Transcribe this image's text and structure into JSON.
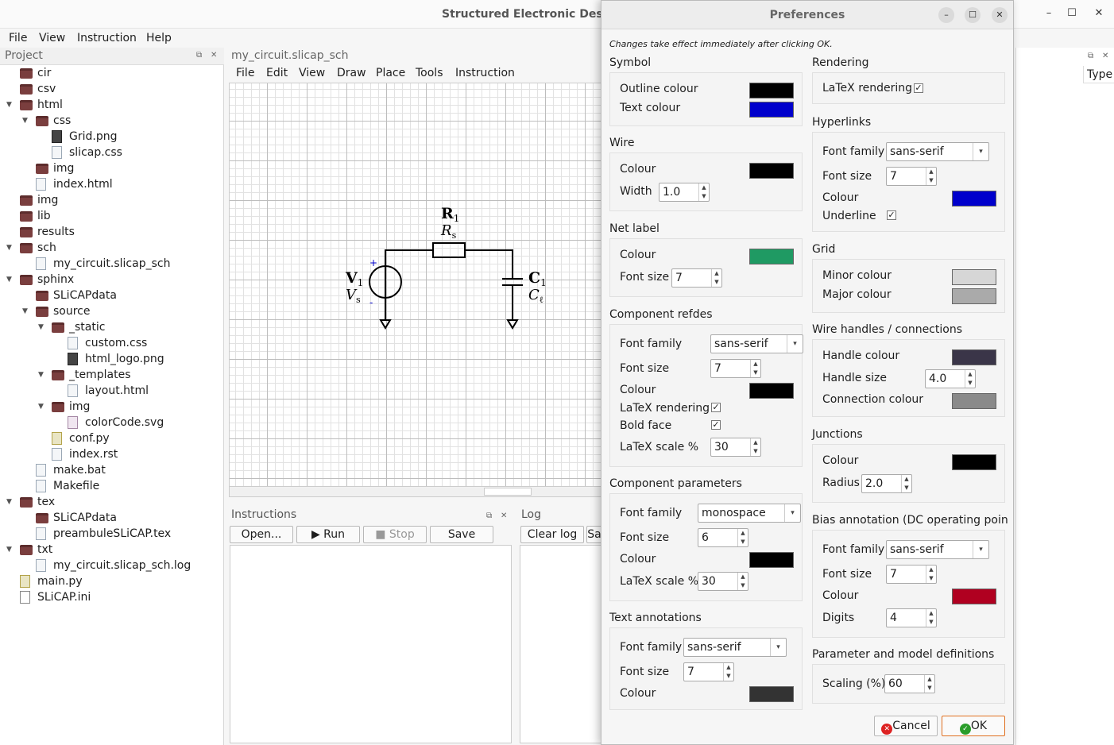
{
  "window": {
    "title": "Structured Electronic Design"
  },
  "menubar": [
    "File",
    "View",
    "Instruction",
    "Help"
  ],
  "project": {
    "title": "Project",
    "tree": [
      {
        "d": 0,
        "t": "folder",
        "n": "cir"
      },
      {
        "d": 0,
        "t": "folder",
        "n": "csv"
      },
      {
        "d": 0,
        "t": "folder",
        "n": "html",
        "open": true
      },
      {
        "d": 1,
        "t": "folder",
        "n": "css",
        "open": true
      },
      {
        "d": 2,
        "t": "img",
        "n": "Grid.png"
      },
      {
        "d": 2,
        "t": "file",
        "n": "slicap.css"
      },
      {
        "d": 1,
        "t": "folder",
        "n": "img"
      },
      {
        "d": 1,
        "t": "file",
        "n": "index.html"
      },
      {
        "d": 0,
        "t": "folder",
        "n": "img"
      },
      {
        "d": 0,
        "t": "folder",
        "n": "lib"
      },
      {
        "d": 0,
        "t": "folder",
        "n": "results"
      },
      {
        "d": 0,
        "t": "folder",
        "n": "sch",
        "open": true
      },
      {
        "d": 1,
        "t": "file",
        "n": "my_circuit.slicap_sch"
      },
      {
        "d": 0,
        "t": "folder",
        "n": "sphinx",
        "open": true
      },
      {
        "d": 1,
        "t": "folder",
        "n": "SLiCAPdata"
      },
      {
        "d": 1,
        "t": "folder",
        "n": "source",
        "open": true
      },
      {
        "d": 2,
        "t": "folder",
        "n": "_static",
        "open": true
      },
      {
        "d": 3,
        "t": "file",
        "n": "custom.css"
      },
      {
        "d": 3,
        "t": "img",
        "n": "html_logo.png"
      },
      {
        "d": 2,
        "t": "folder",
        "n": "_templates",
        "open": true
      },
      {
        "d": 3,
        "t": "file",
        "n": "layout.html"
      },
      {
        "d": 2,
        "t": "folder",
        "n": "img",
        "open": true
      },
      {
        "d": 3,
        "t": "svg",
        "n": "colorCode.svg"
      },
      {
        "d": 2,
        "t": "py",
        "n": "conf.py"
      },
      {
        "d": 2,
        "t": "file",
        "n": "index.rst"
      },
      {
        "d": 1,
        "t": "file",
        "n": "make.bat"
      },
      {
        "d": 1,
        "t": "file",
        "n": "Makefile"
      },
      {
        "d": 0,
        "t": "folder",
        "n": "tex",
        "open": true
      },
      {
        "d": 1,
        "t": "folder",
        "n": "SLiCAPdata"
      },
      {
        "d": 1,
        "t": "file",
        "n": "preambuleSLiCAP.tex"
      },
      {
        "d": 0,
        "t": "folder",
        "n": "txt",
        "open": true
      },
      {
        "d": 1,
        "t": "file",
        "n": "my_circuit.slicap_sch.log"
      },
      {
        "d": 0,
        "t": "py",
        "n": "main.py"
      },
      {
        "d": 0,
        "t": "ini",
        "n": "SLiCAP.ini"
      }
    ]
  },
  "editor": {
    "tab": "my_circuit.slicap_sch",
    "menus": [
      "File",
      "Edit",
      "View",
      "Draw",
      "Place",
      "Tools",
      "Instruction"
    ]
  },
  "schematic": {
    "r_ref": "R",
    "r_sub": "1",
    "r_val": "R",
    "r_val_sub": "s",
    "v_ref": "V",
    "v_sub": "1",
    "v_val": "V",
    "v_val_sub": "s",
    "c_ref": "C",
    "c_sub": "1",
    "c_val": "C",
    "c_val_sub": "ℓ",
    "plus": "+",
    "minus": "-"
  },
  "instructions": {
    "title": "Instructions",
    "open": "Open...",
    "run": "Run",
    "stop": "Stop",
    "save": "Save"
  },
  "log": {
    "title": "Log",
    "clear": "Clear log",
    "save_partial": "Sa"
  },
  "right_dock": {
    "type_header": "Type"
  },
  "prefs": {
    "title": "Preferences",
    "note": "Changes take effect immediately after clicking OK.",
    "symbol": {
      "title": "Symbol",
      "outline": "Outline colour",
      "text": "Text colour",
      "outline_color": "#000000",
      "text_color": "#0000cc"
    },
    "wire": {
      "title": "Wire",
      "colour": "Colour",
      "width": "Width",
      "width_val": "1.0",
      "color": "#000000"
    },
    "net": {
      "title": "Net label",
      "colour": "Colour",
      "fs": "Font size",
      "fs_val": "7",
      "color": "#1f9a63"
    },
    "refdes": {
      "title": "Component refdes",
      "ff": "Font family",
      "ff_val": "sans-serif",
      "fs": "Font size",
      "fs_val": "7",
      "colour": "Colour",
      "latex": "LaTeX rendering",
      "bold": "Bold face",
      "scale": "LaTeX scale %",
      "scale_val": "30",
      "color": "#000000"
    },
    "params": {
      "title": "Component parameters",
      "ff": "Font family",
      "ff_val": "monospace",
      "fs": "Font size",
      "fs_val": "6",
      "colour": "Colour",
      "scale": "LaTeX scale %",
      "scale_val": "30",
      "color": "#000000"
    },
    "text": {
      "title": "Text annotations",
      "ff": "Font family",
      "ff_val": "sans-serif",
      "fs": "Font size",
      "fs_val": "7",
      "colour": "Colour",
      "color": "#333333"
    },
    "rendering": {
      "title": "Rendering",
      "latex": "LaTeX rendering"
    },
    "hyper": {
      "title": "Hyperlinks",
      "ff": "Font family",
      "ff_val": "sans-serif",
      "fs": "Font size",
      "fs_val": "7",
      "colour": "Colour",
      "underline": "Underline",
      "color": "#0000cc"
    },
    "grid": {
      "title": "Grid",
      "minor": "Minor colour",
      "major": "Major colour",
      "minor_color": "#d6d6d6",
      "major_color": "#aaaaaa"
    },
    "handles": {
      "title": "Wire handles / connections",
      "hc": "Handle colour",
      "hs": "Handle size",
      "hs_val": "4.0",
      "cc": "Connection colour",
      "hc_color": "#3a3548",
      "cc_color": "#8a8a8a"
    },
    "junctions": {
      "title": "Junctions",
      "colour": "Colour",
      "radius": "Radius",
      "radius_val": "2.0",
      "color": "#000000"
    },
    "bias": {
      "title": "Bias annotation (DC operating point)",
      "ff": "Font family",
      "ff_val": "sans-serif",
      "fs": "Font size",
      "fs_val": "7",
      "colour": "Colour",
      "digits": "Digits",
      "digits_val": "4",
      "color": "#b00020"
    },
    "pmd": {
      "title": "Parameter and model definitions",
      "scaling": "Scaling (%)",
      "scaling_val": "60"
    },
    "cancel": "Cancel",
    "ok": "OK"
  }
}
